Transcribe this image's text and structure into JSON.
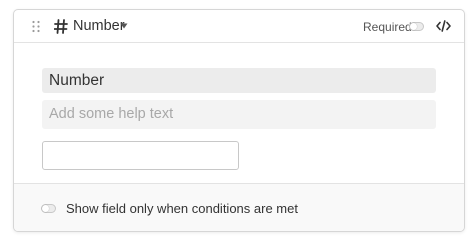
{
  "header": {
    "field_type_label": "Number",
    "required_label": "Required",
    "required_enabled": false,
    "icons": [
      "drag-handle-icon",
      "hash-icon",
      "chevron-down-icon",
      "code-icon"
    ]
  },
  "field": {
    "name_value": "Number",
    "help_placeholder": "Add some help text",
    "preview_value": ""
  },
  "footer": {
    "conditions_label": "Show field only when conditions are met",
    "conditions_enabled": false
  },
  "colors": {
    "border": "#d6d6d6",
    "input_bg": "#ececec",
    "footer_bg": "#f9f9f9",
    "text": "#333333",
    "placeholder": "#a8a8a8"
  }
}
